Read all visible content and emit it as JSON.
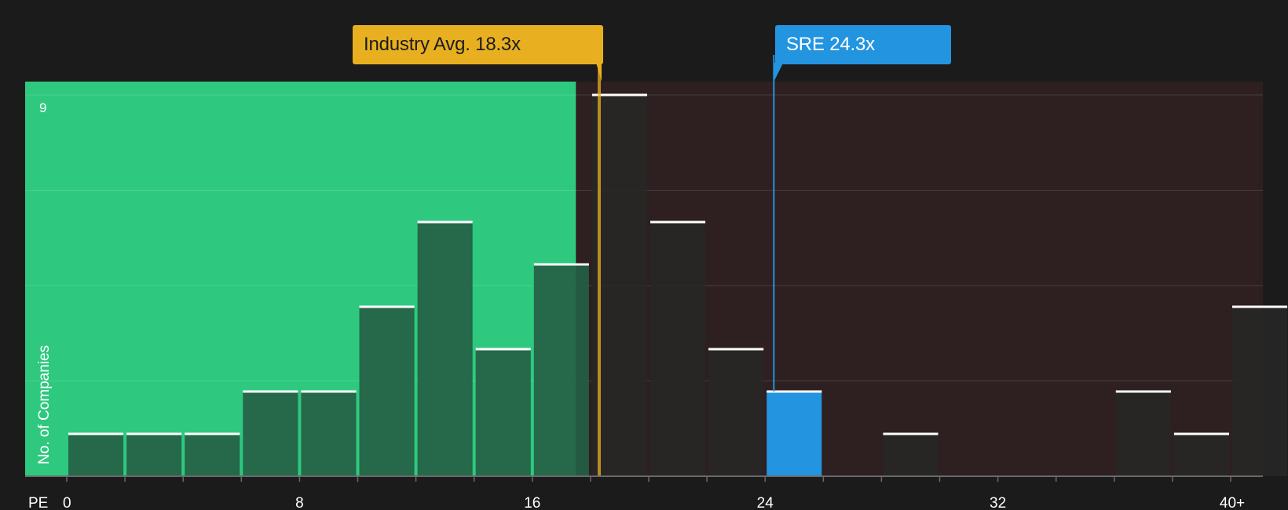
{
  "colors": {
    "background": "#1b1b1b",
    "below_zone": "#2ec97f",
    "above_zone": "#2e1f20",
    "bar_in_green": "#255f45",
    "bar_dark": "#272727",
    "company_bar": "#2394e0",
    "industry_line": "#e8b020",
    "company_line": "#2394e0",
    "bar_cap": "#ffffff"
  },
  "chart_data": {
    "type": "bar",
    "metric_label": "PE",
    "ylabel": "No. of Companies",
    "ytick_label": "9",
    "xtick_labels": [
      "0",
      "8",
      "16",
      "24",
      "32",
      "40+"
    ],
    "xlim": [
      0,
      41
    ],
    "ylim": [
      0,
      9
    ],
    "bin_width": 2,
    "bins": [
      {
        "start": 0,
        "count": 1
      },
      {
        "start": 2,
        "count": 1
      },
      {
        "start": 4,
        "count": 1
      },
      {
        "start": 6,
        "count": 2
      },
      {
        "start": 8,
        "count": 2
      },
      {
        "start": 10,
        "count": 4
      },
      {
        "start": 12,
        "count": 6
      },
      {
        "start": 14,
        "count": 3
      },
      {
        "start": 16,
        "count": 5
      },
      {
        "start": 18,
        "count": 9
      },
      {
        "start": 20,
        "count": 6
      },
      {
        "start": 22,
        "count": 3
      },
      {
        "start": 24,
        "count": 2,
        "highlight": true
      },
      {
        "start": 26,
        "count": 0
      },
      {
        "start": 28,
        "count": 1
      },
      {
        "start": 30,
        "count": 0
      },
      {
        "start": 32,
        "count": 0
      },
      {
        "start": 34,
        "count": 0
      },
      {
        "start": 36,
        "count": 2
      },
      {
        "start": 38,
        "count": 1
      },
      {
        "start": 40,
        "count": 4
      }
    ],
    "industry_avg": {
      "value": 18.3,
      "label": "Industry Avg. 18.3x"
    },
    "company": {
      "ticker": "SRE",
      "value": 24.3,
      "label": "SRE 24.3x"
    }
  }
}
